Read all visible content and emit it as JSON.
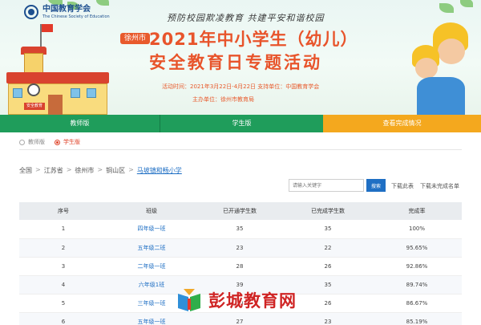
{
  "banner": {
    "logo": {
      "name": "中国教育学会",
      "sub": "The Chinese Society of Education"
    },
    "slogan": "预防校园欺凌教育  共建平安和谐校园",
    "city_badge": "徐州市",
    "title_line1": "2021年中小学生（幼儿）",
    "title_line2": "安全教育日专题活动",
    "activity_time": "活动时间：2021年3月22日-4月22日   支持单位：中国教育学会",
    "organizer": "主办单位：徐州市教育局",
    "school_sign": "安全教育"
  },
  "nav": {
    "teacher": "教师版",
    "student": "学生版",
    "completion": "查看完成情况"
  },
  "roles": {
    "teacher": "教师版",
    "student": "学生版"
  },
  "breadcrumb": {
    "items": [
      "全国",
      "江苏省",
      "徐州市",
      "铜山区"
    ],
    "current": "马坡镇和畅小学"
  },
  "search": {
    "placeholder": "请输入关键字",
    "button": "搜索",
    "download_this": "下载此表",
    "download_unfinished": "下载未完成名单"
  },
  "table": {
    "headers": [
      "序号",
      "班级",
      "已开通学生数",
      "已完成学生数",
      "完成率"
    ],
    "rows": [
      [
        "1",
        "四年级一班",
        "35",
        "35",
        "100%"
      ],
      [
        "2",
        "五年级二班",
        "23",
        "22",
        "95.65%"
      ],
      [
        "3",
        "二年级一班",
        "28",
        "26",
        "92.86%"
      ],
      [
        "4",
        "六年级1班",
        "39",
        "35",
        "89.74%"
      ],
      [
        "5",
        "三年级一班",
        "30",
        "26",
        "86.67%"
      ],
      [
        "6",
        "五年级一班",
        "27",
        "23",
        "85.19%"
      ]
    ]
  },
  "watermark": {
    "text": "彭城教育网"
  },
  "colors": {
    "nav_green": "#1f9d5b",
    "nav_orange": "#f4a81e",
    "title_orange": "#e8542b",
    "link_blue": "#1f6fc4",
    "watermark_red": "#cf2424"
  }
}
